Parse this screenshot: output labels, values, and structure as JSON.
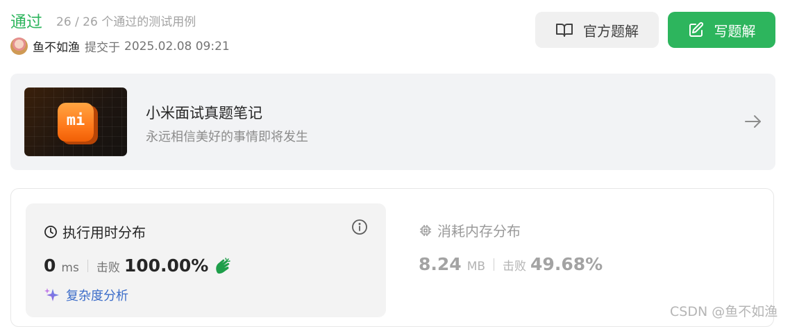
{
  "header": {
    "status": "通过",
    "testcases": "26 / 26 个通过的测试用例",
    "username": "鱼不如渔",
    "submitted_label": "提交于",
    "submitted_time": "2025.02.08 09:21"
  },
  "buttons": {
    "official_solution": "官方题解",
    "write_solution": "写题解"
  },
  "promo": {
    "title": "小米面试真题笔记",
    "subtitle": "永远相信美好的事情即将发生",
    "logo_text": "mi"
  },
  "runtime": {
    "title": "执行用时分布",
    "value": "0",
    "unit": "ms",
    "beat_label": "击败",
    "beat_value": "100.00%",
    "complexity_label": "复杂度分析"
  },
  "memory": {
    "title": "消耗内存分布",
    "value": "8.24",
    "unit": "MB",
    "beat_label": "击败",
    "beat_value": "49.68%"
  },
  "watermark": "CSDN @鱼不如渔",
  "colors": {
    "accent_green": "#2db55d",
    "link_blue": "#3b6cc9",
    "brand_orange": "#ff7a1c"
  },
  "icons": {
    "official_solution": "book-icon",
    "write_solution": "edit-icon",
    "promo_arrow": "arrow-right-icon",
    "runtime": "clock-icon",
    "info": "info-icon",
    "memory": "chip-icon",
    "celebrate": "clap-icon",
    "complexity": "sparkle-icon"
  }
}
